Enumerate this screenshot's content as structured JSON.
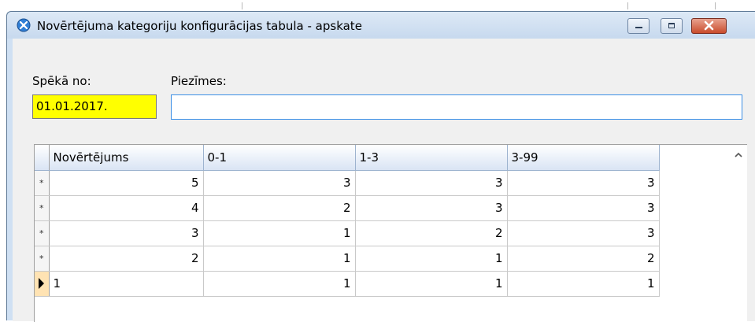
{
  "window": {
    "title": "Novērtējuma kategoriju konfigurācijas tabula - apskate",
    "icon": "app-icon"
  },
  "form": {
    "valid_from_label": "Spēkā no:",
    "valid_from_value": "01.01.2017.",
    "notes_label": "Piezīmes:",
    "notes_value": ""
  },
  "grid": {
    "columns": [
      "Novērtējums",
      "0-1",
      "1-3",
      "3-99"
    ],
    "rows": [
      {
        "marker": "*",
        "cells": [
          "5",
          "3",
          "3",
          "3"
        ]
      },
      {
        "marker": "*",
        "cells": [
          "4",
          "2",
          "3",
          "3"
        ]
      },
      {
        "marker": "*",
        "cells": [
          "3",
          "1",
          "2",
          "3"
        ]
      },
      {
        "marker": "*",
        "cells": [
          "2",
          "1",
          "1",
          "2"
        ]
      },
      {
        "marker": "current-row-arrow",
        "cells": [
          "1",
          "1",
          "1",
          "1"
        ]
      }
    ]
  },
  "colors": {
    "date_field_bg": "#ffff00",
    "notes_field_border": "#3a8ee6",
    "close_button": "#c94c2c"
  }
}
